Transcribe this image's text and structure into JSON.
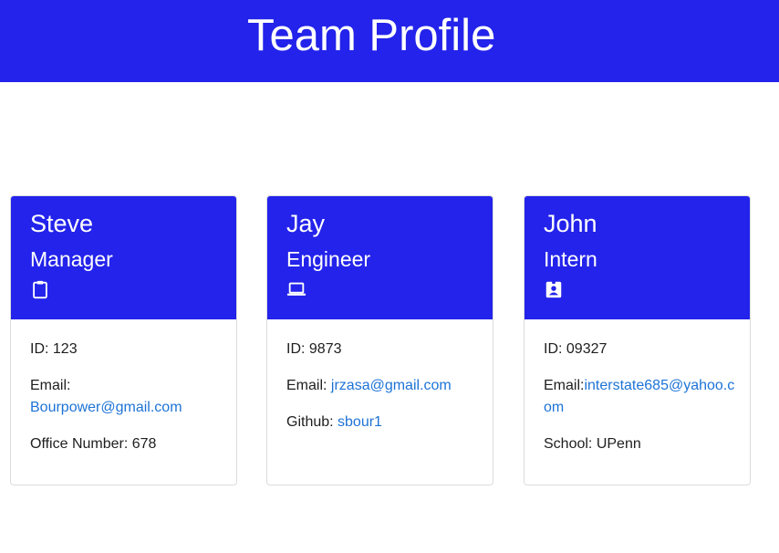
{
  "header": {
    "title": "Team Profile",
    "bg_color": "#2323eb"
  },
  "cards": [
    {
      "name": "Steve",
      "role": "Manager",
      "icon": "clipboard-icon",
      "id_label": "ID: ",
      "id_value": "123",
      "email_label": "Email: ",
      "email_value": "Bourpower@gmail.com",
      "extra_label": "Office Number: ",
      "extra_value": "678"
    },
    {
      "name": "Jay",
      "role": "Engineer",
      "icon": "laptop-icon",
      "id_label": "ID: ",
      "id_value": "9873",
      "email_label": "Email: ",
      "email_value": "jrzasa@gmail.com",
      "extra_label": "Github: ",
      "extra_value": "sbour1"
    },
    {
      "name": "John",
      "role": "Intern",
      "icon": "badge-icon",
      "id_label": "ID: ",
      "id_value": "09327",
      "email_label": "Email:",
      "email_value": "interstate685@yahoo.com",
      "extra_label": "School: ",
      "extra_value": "UPenn"
    }
  ],
  "colors": {
    "accent": "#2323eb",
    "link": "#1d73d6"
  }
}
